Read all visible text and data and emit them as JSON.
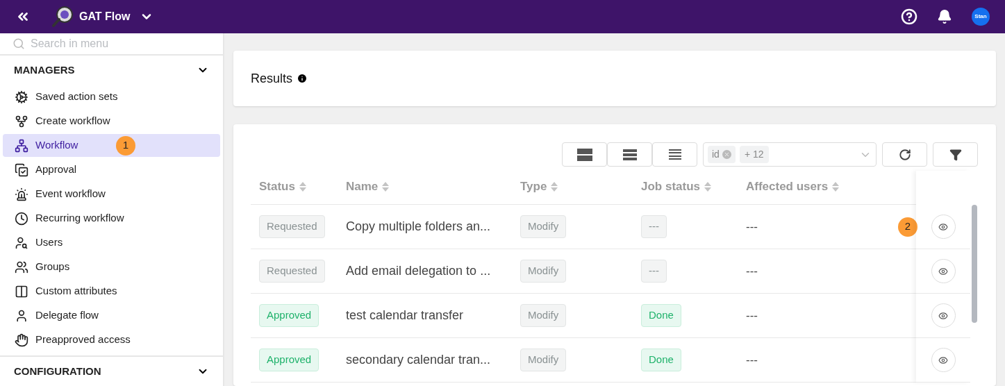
{
  "header": {
    "app_name": "GAT Flow",
    "avatar": "Stan"
  },
  "sidebar": {
    "search": {
      "placeholder": "Search in menu"
    },
    "sections": [
      {
        "title": "MANAGERS",
        "items": [
          {
            "label": "Saved action sets",
            "selected": false
          },
          {
            "label": "Create workflow",
            "selected": false
          },
          {
            "label": "Workflow",
            "selected": true,
            "badge": "1"
          },
          {
            "label": "Approval",
            "selected": false
          },
          {
            "label": "Event workflow",
            "selected": false
          },
          {
            "label": "Recurring workflow",
            "selected": false
          },
          {
            "label": "Users",
            "selected": false
          },
          {
            "label": "Groups",
            "selected": false
          },
          {
            "label": "Custom attributes",
            "selected": false
          },
          {
            "label": "Delegate flow",
            "selected": false
          },
          {
            "label": "Preapproved access",
            "selected": false
          }
        ]
      },
      {
        "title": "CONFIGURATION"
      }
    ]
  },
  "results": {
    "title": "Results"
  },
  "toolbar": {
    "column_tags": [
      "id"
    ],
    "more_tag": "+ 12"
  },
  "table": {
    "columns": [
      "Status",
      "Name",
      "Type",
      "Job status",
      "Affected users"
    ],
    "rows": [
      {
        "status": {
          "text": "Requested",
          "kind": "muted"
        },
        "name": "Copy multiple folders an...",
        "type": "Modify",
        "job_status": {
          "text": "---",
          "kind": "muted"
        },
        "affected_users": "---",
        "badge": "2"
      },
      {
        "status": {
          "text": "Requested",
          "kind": "muted"
        },
        "name": "Add email delegation to ...",
        "type": "Modify",
        "job_status": {
          "text": "---",
          "kind": "muted"
        },
        "affected_users": "---"
      },
      {
        "status": {
          "text": "Approved",
          "kind": "success"
        },
        "name": "test calendar transfer",
        "type": "Modify",
        "job_status": {
          "text": "Done",
          "kind": "success"
        },
        "affected_users": "---"
      },
      {
        "status": {
          "text": "Approved",
          "kind": "success"
        },
        "name": "secondary calendar tran...",
        "type": "Modify",
        "job_status": {
          "text": "Done",
          "kind": "success"
        },
        "affected_users": "---"
      }
    ]
  }
}
